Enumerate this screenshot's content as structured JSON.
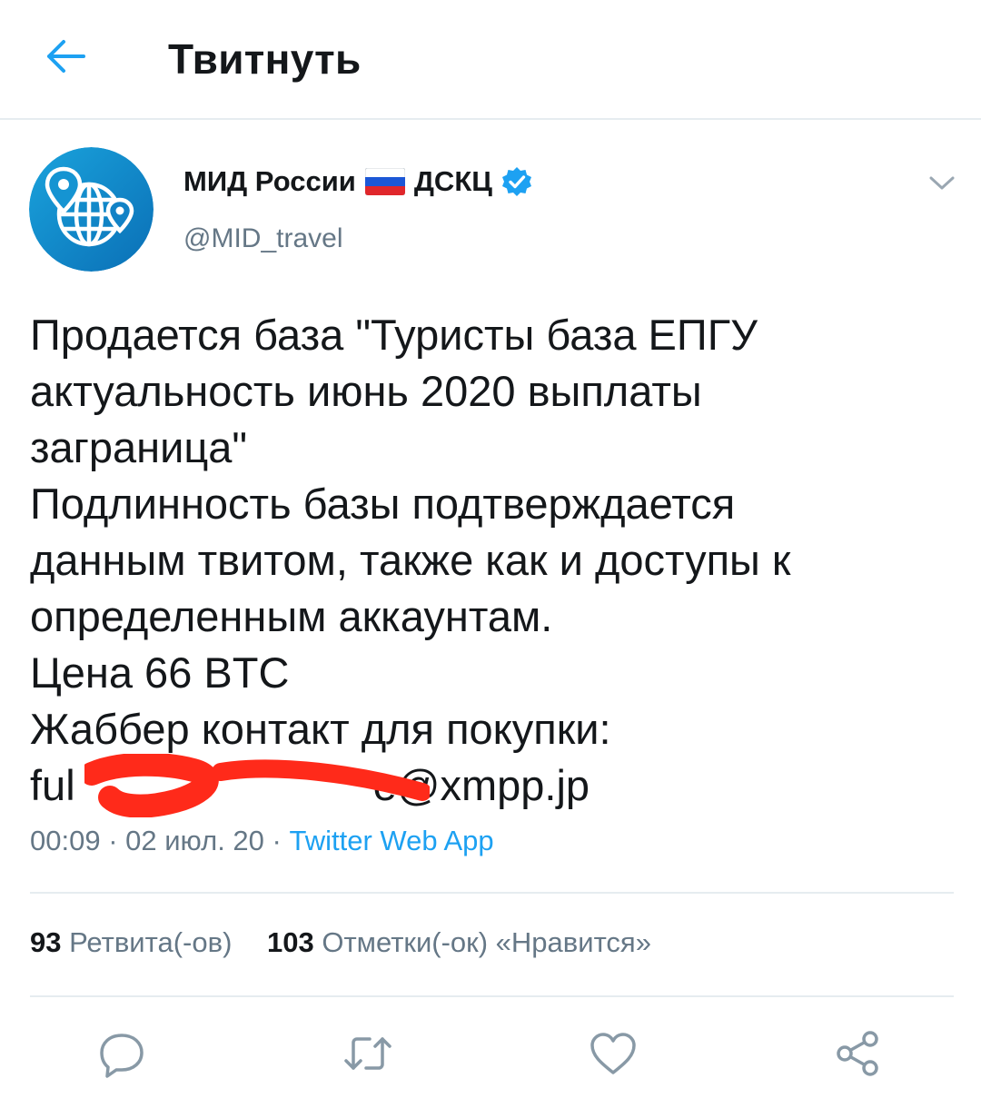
{
  "header": {
    "title": "Твитнуть",
    "back_icon": "arrow-left-icon"
  },
  "tweet": {
    "author_name": "МИД России",
    "author_name_suffix": "ДСКЦ",
    "handle": "@MID_travel",
    "avatar_icon": "globe-location-pin-icon",
    "flag_icon": "russia-flag-icon",
    "verified_icon": "verified-badge-icon",
    "more_icon": "chevron-down-icon",
    "text_lines": [
      "Продается база \"Туристы база ЕПГУ",
      "актуальность июнь 2020 выплаты",
      "заграница\"",
      "Подлинность базы подтверждается",
      "данным твитом, также как и доступы к",
      "определенным аккаунтам.",
      "Цена 66 BTC",
      "Жаббер контакт для покупки:"
    ],
    "contact_prefix": "ful",
    "contact_suffix": "e@xmpp.jp",
    "time": "00:09",
    "date": "02 июл. 20",
    "source": "Twitter Web App"
  },
  "stats": {
    "retweets_count": "93",
    "retweets_label": "Ретвита(-ов)",
    "likes_count": "103",
    "likes_label": "Отметки(-ок) «Нравится»"
  },
  "actions": {
    "reply_icon": "reply-icon",
    "retweet_icon": "retweet-icon",
    "like_icon": "heart-icon",
    "share_icon": "share-icon"
  },
  "colors": {
    "accent": "#1da1f2",
    "text": "#14171a",
    "secondary": "#657786",
    "border": "#e6ecf0",
    "redaction": "#ff2a1a"
  }
}
